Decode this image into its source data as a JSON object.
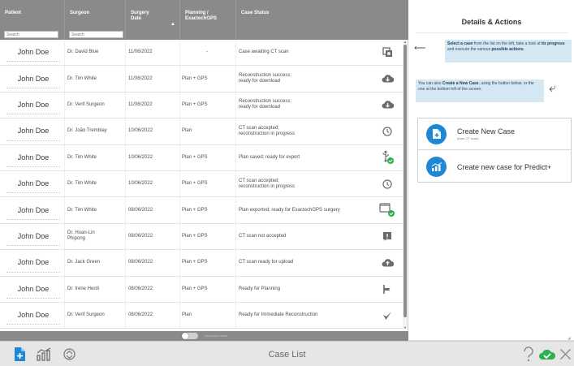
{
  "table": {
    "headers": {
      "patient": "Patient",
      "surgeon": "Surgeon",
      "surgery_date": "Surgery\nDate",
      "planning": "Planning /\nExactechGPS",
      "case_status": "Case Status"
    },
    "search": {
      "patient_placeholder": "Search",
      "surgeon_placeholder": "Search"
    },
    "rows": [
      {
        "patient": "John Doe",
        "surgeon": "Dr. David Blue",
        "date": "11/06/2022",
        "plan": "-",
        "status": "Case awaiting CT scan",
        "icon": "copy-icon"
      },
      {
        "patient": "John Doe",
        "surgeon": "Dr. Tim White",
        "date": "11/06/2022",
        "plan": "Plan + GPS",
        "status": "Reconstruction success;\nready for download",
        "icon": "cloud-download-icon"
      },
      {
        "patient": "John Doe",
        "surgeon": "Dr. Verif Surgeon",
        "date": "11/06/2022",
        "plan": "Plan + GPS",
        "status": "Reconstruction success;\nready for download",
        "icon": "cloud-download-icon"
      },
      {
        "patient": "John Doe",
        "surgeon": "Dr. João Tremblay",
        "date": "10/06/2022",
        "plan": "Plan",
        "status": "CT scan accepted;\nreconstruction in progress",
        "icon": "clock-icon"
      },
      {
        "patient": "John Doe",
        "surgeon": "Dr. Tim White",
        "date": "10/06/2022",
        "plan": "Plan + GPS",
        "status": "Plan saved; ready for export",
        "icon": "usb-check-icon"
      },
      {
        "patient": "John Doe",
        "surgeon": "Dr. Tim White",
        "date": "10/06/2022",
        "plan": "Plan + GPS",
        "status": "CT scan accepted;\nreconstruction in progress",
        "icon": "clock-icon"
      },
      {
        "patient": "John Doe",
        "surgeon": "Dr. Tim White",
        "date": "08/06/2022",
        "plan": "Plan + GPS",
        "status": "Plan exported; ready for ExactechGPS surgery",
        "icon": "monitor-check-icon"
      },
      {
        "patient": "John Doe",
        "surgeon": "Dr. Hoan-Lin\nPhipong",
        "date": "08/06/2022",
        "plan": "Plan + GPS",
        "status": "CT scan not accepted",
        "icon": "alert-message-icon"
      },
      {
        "patient": "John Doe",
        "surgeon": "Dr. Jack Green",
        "date": "08/06/2022",
        "plan": "Plan + GPS",
        "status": "CT scan ready for upload",
        "icon": "cloud-upload-icon"
      },
      {
        "patient": "John Doe",
        "surgeon": "Dr. Irene Herdi",
        "date": "08/06/2022",
        "plan": "Plan + GPS",
        "status": "Ready for Planning",
        "icon": "flag-icon"
      },
      {
        "patient": "John Doe",
        "surgeon": "Dr. Verif Surgeon",
        "date": "08/06/2022",
        "plan": "Plan",
        "status": "Ready for Immediate Reconstruction",
        "icon": "checkmark-icon"
      }
    ]
  },
  "toggle": {
    "label": "view past cases"
  },
  "details": {
    "title": "Details & Actions",
    "hint_top": {
      "pre": "Select a case",
      "mid1": " from the list on the left, take a look at ",
      "bold2": "its progress",
      "mid2": " and execute the various ",
      "bold3": "possible actions",
      "end": "."
    },
    "hint_bottom": {
      "pre": "You can also ",
      "bold": "Create a New Case",
      "end": ", using the button below, or the one at the bottom left of the screen."
    },
    "actions": [
      {
        "label": "Create New Case",
        "sublabel": "(from CT scan)",
        "icon": "new-file-icon"
      },
      {
        "label": "Create new case for Predict+",
        "sublabel": "",
        "icon": "chart-icon"
      }
    ]
  },
  "bottom_bar": {
    "title": "Case List"
  },
  "colors": {
    "accent": "#1e88d6",
    "header_gray": "#8a8a8a",
    "success_green": "#2bb24c",
    "hint_blue": "#d6e7f4"
  }
}
